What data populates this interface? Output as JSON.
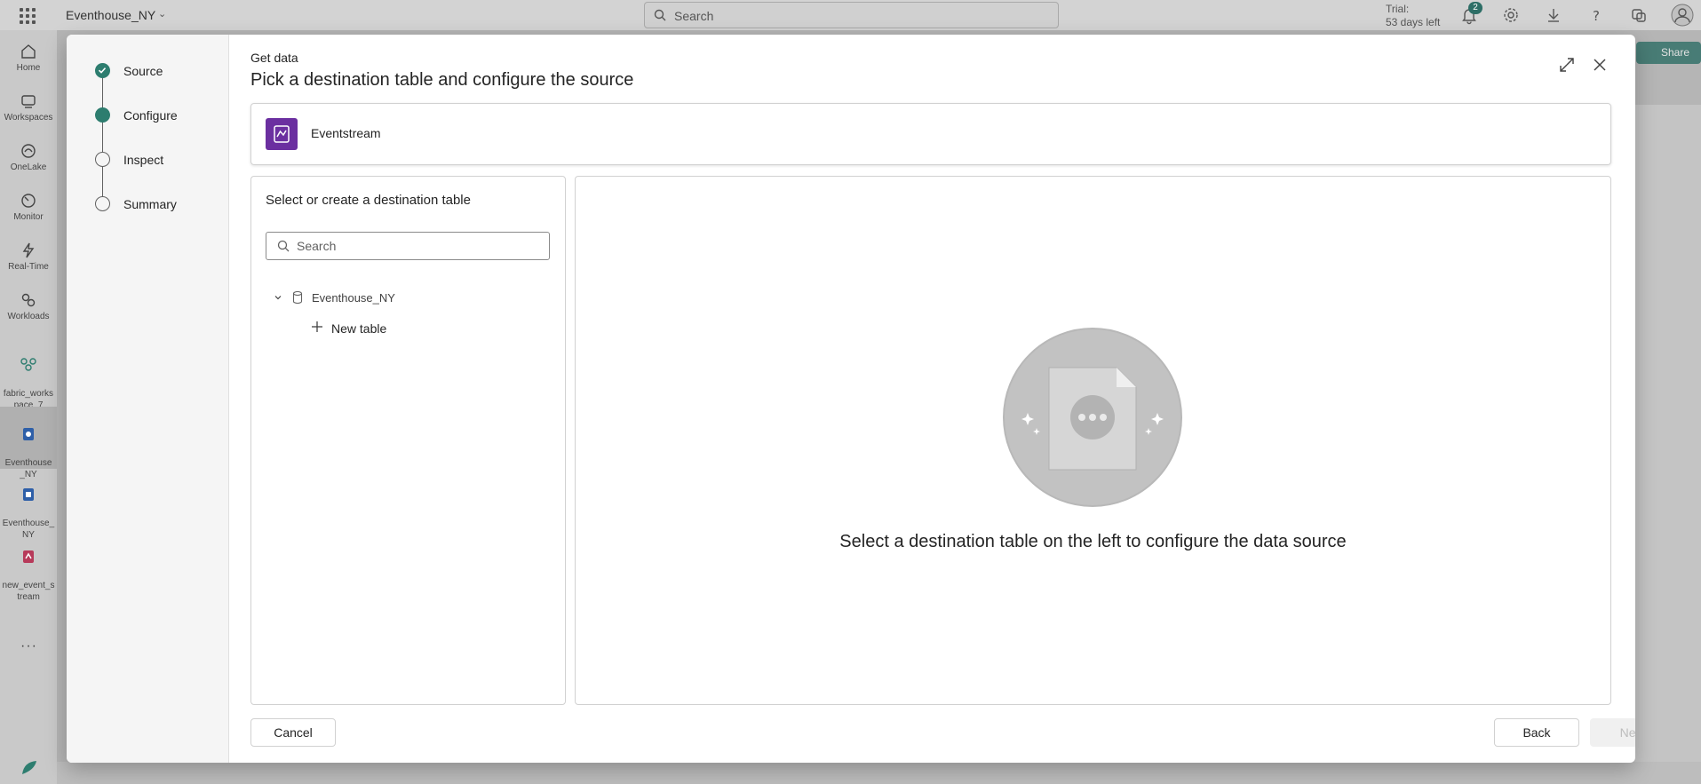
{
  "app": {
    "workspace_name": "Eventhouse_NY",
    "search_placeholder": "Search",
    "trial_line1": "Trial:",
    "trial_line2": "53 days left",
    "notification_count": "2",
    "share_label": "Share"
  },
  "left_rail": {
    "items": [
      {
        "label": "Home",
        "icon": "home-icon"
      },
      {
        "label": "Workspaces",
        "icon": "workspaces-icon"
      },
      {
        "label": "OneLake",
        "icon": "onelake-icon"
      },
      {
        "label": "Monitor",
        "icon": "monitor-icon"
      },
      {
        "label": "Real-Time",
        "icon": "real-time-icon"
      },
      {
        "label": "Workloads",
        "icon": "workloads-icon"
      },
      {
        "label": "fabric_works\npace_7",
        "icon": "workspace-icon"
      },
      {
        "label": "Eventhouse\n_NY",
        "icon": "eventhouse-icon"
      },
      {
        "label": "Eventhouse_\nNY",
        "icon": "kql-database-icon"
      },
      {
        "label": "new_event_s\ntream",
        "icon": "eventstream-icon"
      }
    ],
    "more": "···"
  },
  "dialog": {
    "breadcrumb": "Get data",
    "title": "Pick a destination table and configure the source",
    "steps": [
      {
        "label": "Source",
        "state": "done"
      },
      {
        "label": "Configure",
        "state": "current"
      },
      {
        "label": "Inspect",
        "state": "pending"
      },
      {
        "label": "Summary",
        "state": "pending"
      }
    ],
    "source_name": "Eventstream",
    "destination": {
      "heading": "Select or create a destination table",
      "search_placeholder": "Search",
      "database": "Eventhouse_NY",
      "new_table": "New table"
    },
    "empty_message": "Select a destination table on the left to configure the data source",
    "buttons": {
      "cancel": "Cancel",
      "back": "Back",
      "next": "Next"
    }
  },
  "colors": {
    "accent": "#2d7d6f",
    "eventstream": "#6b2fa0",
    "disabled_text": "#bdbdbd"
  }
}
